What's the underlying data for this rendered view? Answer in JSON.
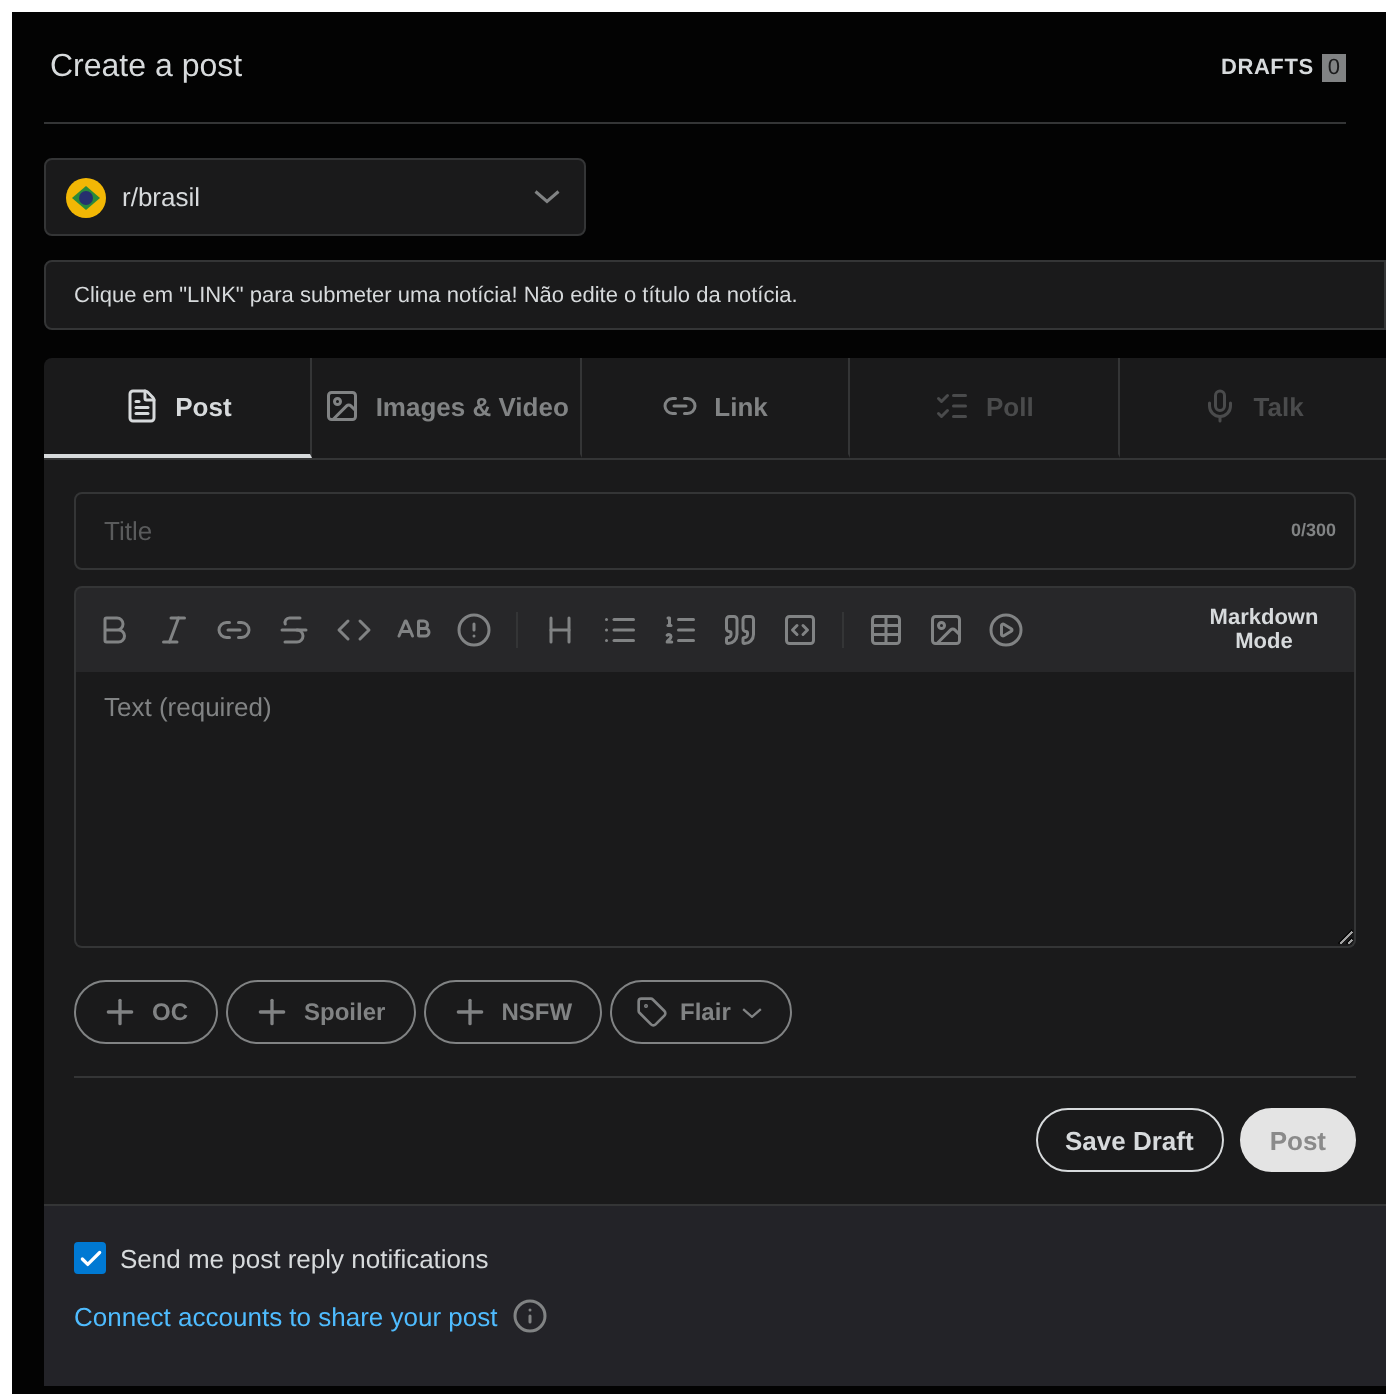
{
  "header": {
    "title": "Create a post",
    "drafts_label": "DRAFTS",
    "drafts_count": "0"
  },
  "community": {
    "name": "r/brasil"
  },
  "rule_banner": "Clique em \"LINK\" para submeter uma notícia! Não edite o título da notícia.",
  "tabs": [
    {
      "label": "Post",
      "selected": true,
      "disabled": false
    },
    {
      "label": "Images & Video",
      "selected": false,
      "disabled": false
    },
    {
      "label": "Link",
      "selected": false,
      "disabled": false
    },
    {
      "label": "Poll",
      "selected": false,
      "disabled": true
    },
    {
      "label": "Talk",
      "selected": false,
      "disabled": true
    }
  ],
  "title_field": {
    "placeholder": "Title",
    "counter": "0/300"
  },
  "editor": {
    "mode_button": "Markdown Mode",
    "placeholder": "Text (required)"
  },
  "tags": [
    {
      "label": "OC"
    },
    {
      "label": "Spoiler"
    },
    {
      "label": "NSFW"
    },
    {
      "label": "Flair"
    }
  ],
  "actions": {
    "save_draft": "Save Draft",
    "post": "Post",
    "post_disabled": true
  },
  "footer": {
    "notifications": {
      "label": "Send me post reply notifications",
      "checked": true
    },
    "connect_link": "Connect accounts to share your post"
  }
}
